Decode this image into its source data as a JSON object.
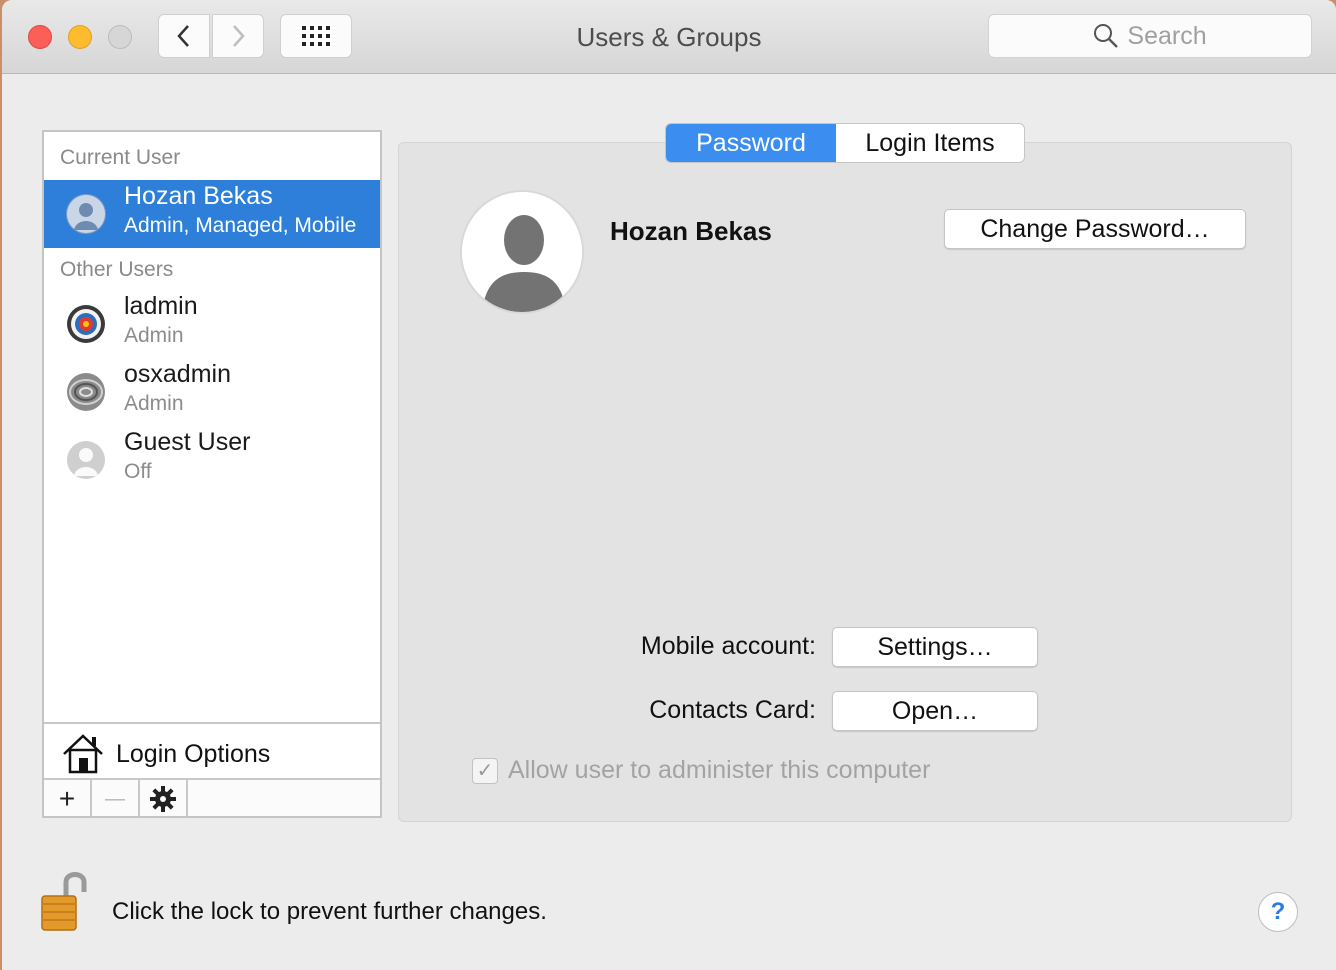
{
  "window": {
    "title": "Users & Groups",
    "search_placeholder": "Search"
  },
  "sidebar": {
    "current_user_label": "Current User",
    "other_users_label": "Other Users",
    "current_user": {
      "name": "Hozan Bekas",
      "role": "Admin, Managed, Mobile"
    },
    "other_users": [
      {
        "name": "ladmin",
        "role": "Admin",
        "avatar": "target-avatar"
      },
      {
        "name": "osxadmin",
        "role": "Admin",
        "avatar": "swirl-avatar"
      },
      {
        "name": "Guest User",
        "role": "Off",
        "avatar": "silhouette-avatar"
      }
    ],
    "login_options_label": "Login Options",
    "toolbar": {
      "add": "+",
      "remove": "—"
    }
  },
  "tabs": {
    "password": "Password",
    "login_items": "Login Items",
    "active": "Password"
  },
  "main": {
    "full_name": "Hozan Bekas",
    "change_password_button": "Change Password…",
    "mobile_account_label": "Mobile account:",
    "settings_button": "Settings…",
    "contacts_card_label": "Contacts Card:",
    "open_button": "Open…",
    "allow_admin_label": "Allow user to administer this computer",
    "allow_admin_checked": true
  },
  "footer": {
    "lock_text": "Click the lock to prevent further changes.",
    "help": "?"
  },
  "colors": {
    "selection": "#2d7fd9",
    "tab_active": "#3b8df0",
    "close": "#fc5f57",
    "minimize": "#fdbc2e"
  }
}
